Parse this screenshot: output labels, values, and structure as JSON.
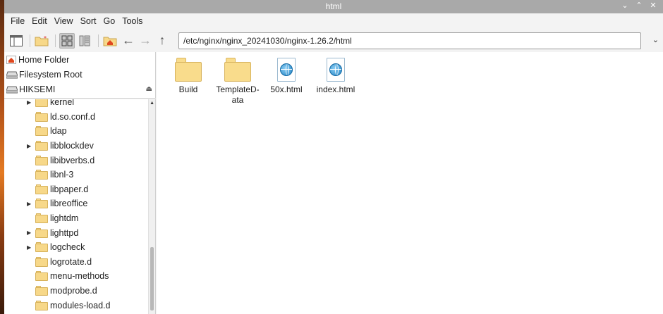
{
  "window": {
    "title": "html",
    "controls": [
      "⌄",
      "⌃",
      "✕"
    ]
  },
  "menu": [
    "File",
    "Edit",
    "View",
    "Sort",
    "Go",
    "Tools"
  ],
  "toolbar": {
    "path": "/etc/nginx/nginx_20241030/nginx-1.26.2/html",
    "path_dropdown": "⌄"
  },
  "places": [
    {
      "label": "Home Folder",
      "icon": "home-icon"
    },
    {
      "label": "Filesystem Root",
      "icon": "drive-icon"
    },
    {
      "label": "HIKSEMI",
      "icon": "drive-icon",
      "eject": "⏏"
    }
  ],
  "tree": [
    {
      "label": "kernel",
      "expandable": true
    },
    {
      "label": "ld.so.conf.d",
      "expandable": false
    },
    {
      "label": "ldap",
      "expandable": false
    },
    {
      "label": "libblockdev",
      "expandable": true
    },
    {
      "label": "libibverbs.d",
      "expandable": false
    },
    {
      "label": "libnl-3",
      "expandable": false
    },
    {
      "label": "libpaper.d",
      "expandable": false
    },
    {
      "label": "libreoffice",
      "expandable": true
    },
    {
      "label": "lightdm",
      "expandable": false
    },
    {
      "label": "lighttpd",
      "expandable": true
    },
    {
      "label": "logcheck",
      "expandable": true
    },
    {
      "label": "logrotate.d",
      "expandable": false
    },
    {
      "label": "menu-methods",
      "expandable": false
    },
    {
      "label": "modprobe.d",
      "expandable": false
    },
    {
      "label": "modules-load.d",
      "expandable": false
    }
  ],
  "files": [
    {
      "name": "Build",
      "type": "folder"
    },
    {
      "name": "TemplateData",
      "display": [
        "TemplateD-",
        "ata"
      ],
      "type": "folder"
    },
    {
      "name": "50x.html",
      "type": "html"
    },
    {
      "name": "index.html",
      "type": "html"
    }
  ]
}
